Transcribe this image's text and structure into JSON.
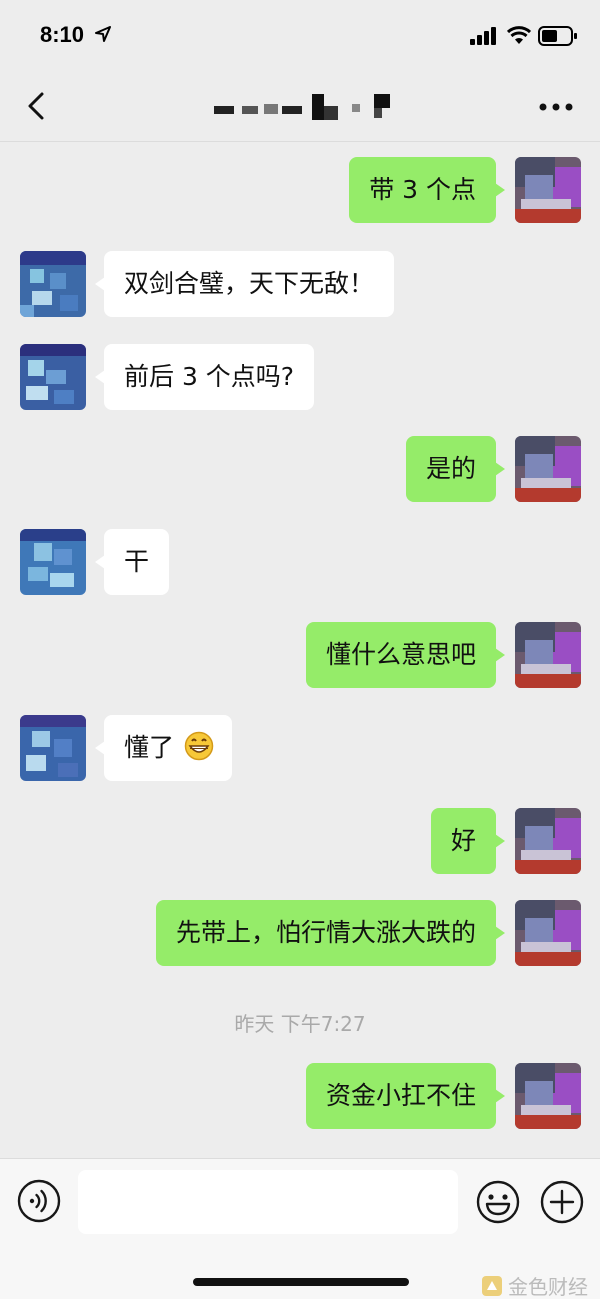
{
  "status_bar": {
    "time": "8:10"
  },
  "nav": {
    "title": ""
  },
  "messages": [
    {
      "side": "me",
      "text": "带 3 个点"
    },
    {
      "side": "other",
      "text": "双剑合璧，天下无敌！"
    },
    {
      "side": "other",
      "text": "前后 3 个点吗?"
    },
    {
      "side": "me",
      "text": "是的"
    },
    {
      "side": "other",
      "text": "干"
    },
    {
      "side": "me",
      "text": "懂什么意思吧"
    },
    {
      "side": "other",
      "text": "懂了",
      "emoji": "grinning-face"
    },
    {
      "side": "me",
      "text": "好"
    },
    {
      "side": "me",
      "text": "先带上，怕行情大涨大跌的"
    },
    {
      "side": "me",
      "text": "资金小扛不住"
    }
  ],
  "timestamp": "昨天 下午7:27",
  "input": {
    "placeholder": ""
  },
  "watermark": "金色财经",
  "colors": {
    "background": "#ededed",
    "my_bubble": "#95ec69",
    "other_bubble": "#ffffff"
  }
}
